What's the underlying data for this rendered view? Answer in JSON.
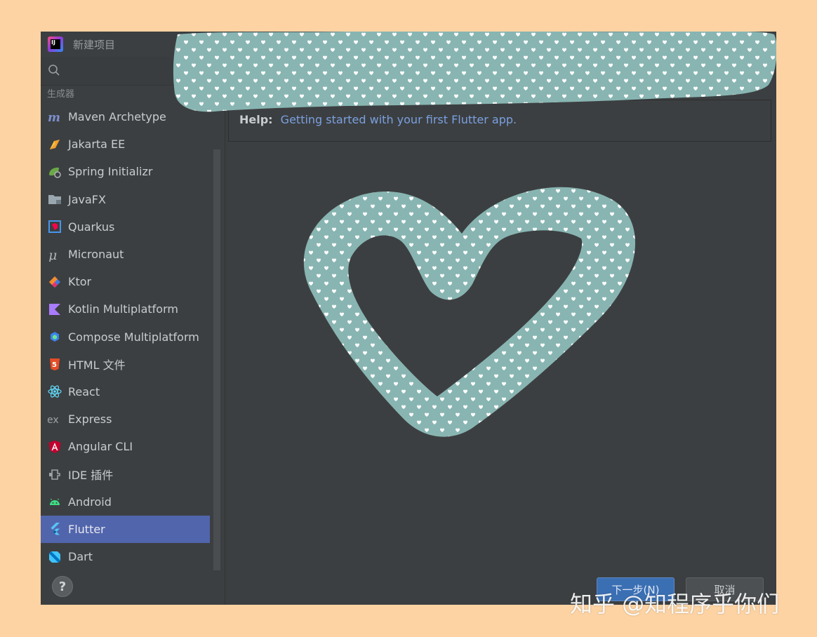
{
  "window": {
    "title": "新建项目"
  },
  "sidebar": {
    "search_placeholder": "",
    "group_label": "生成器",
    "items": [
      {
        "label": "Maven Archetype",
        "icon": "maven-icon"
      },
      {
        "label": "Jakarta EE",
        "icon": "jakarta-icon"
      },
      {
        "label": "Spring Initializr",
        "icon": "spring-icon"
      },
      {
        "label": "JavaFX",
        "icon": "folder-icon"
      },
      {
        "label": "Quarkus",
        "icon": "quarkus-icon"
      },
      {
        "label": "Micronaut",
        "icon": "micronaut-icon"
      },
      {
        "label": "Ktor",
        "icon": "ktor-icon"
      },
      {
        "label": "Kotlin Multiplatform",
        "icon": "kotlin-icon"
      },
      {
        "label": "Compose Multiplatform",
        "icon": "compose-icon"
      },
      {
        "label": "HTML 文件",
        "icon": "html5-icon"
      },
      {
        "label": "React",
        "icon": "react-icon"
      },
      {
        "label": "Express",
        "icon": "express-icon"
      },
      {
        "label": "Angular CLI",
        "icon": "angular-icon"
      },
      {
        "label": "IDE 插件",
        "icon": "plugin-icon"
      },
      {
        "label": "Android",
        "icon": "android-icon"
      },
      {
        "label": "Flutter",
        "icon": "flutter-icon",
        "selected": true
      },
      {
        "label": "Dart",
        "icon": "dart-icon"
      }
    ]
  },
  "help": {
    "prefix": "Help:",
    "link_text": "Getting started with your first Flutter app."
  },
  "footer": {
    "help_button": "?",
    "next_label": "下一步(N)",
    "cancel_label": "取消"
  },
  "watermark": "知乎 @知程序乎你们",
  "colors": {
    "page_background": "#fdd3a3",
    "window_background": "#3c3f41",
    "selection": "#5165ad",
    "sticker_teal": "#88b5b2",
    "link": "#7aa0e0"
  }
}
